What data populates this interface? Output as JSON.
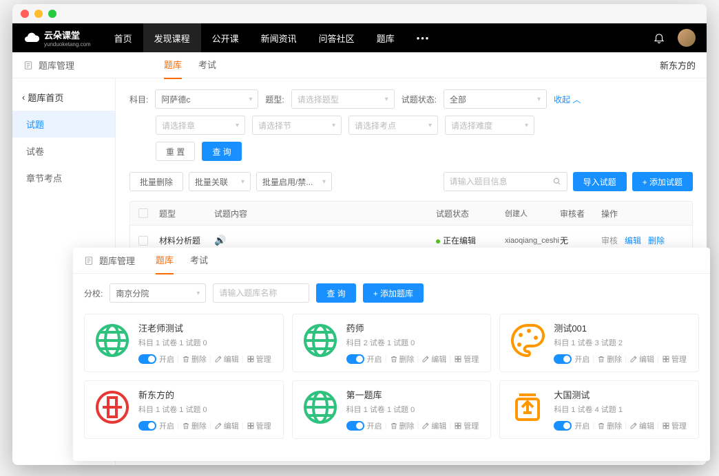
{
  "logo": {
    "text": "云朵课堂",
    "sub": "yunduoketang.com"
  },
  "nav": {
    "items": [
      "首页",
      "发现课程",
      "公开课",
      "新闻资讯",
      "问答社区",
      "题库"
    ],
    "active_index": 1
  },
  "subheader": {
    "title": "题库管理",
    "tabs": [
      "题库",
      "考试"
    ],
    "active_tab": 0,
    "right_text": "新东方的"
  },
  "sidebar": {
    "back": "题库首页",
    "items": [
      "试题",
      "试卷",
      "章节考点"
    ],
    "active_index": 0
  },
  "filters": {
    "subject_label": "科目:",
    "subject_value": "阿萨德c",
    "type_label": "题型:",
    "type_placeholder": "请选择题型",
    "status_label": "试题状态:",
    "status_value": "全部",
    "collapse": "收起",
    "chapter_placeholder": "请选择章",
    "section_placeholder": "请选择节",
    "point_placeholder": "请选择考点",
    "difficulty_placeholder": "请选择难度",
    "reset": "重 置",
    "query": "查 询"
  },
  "toolbar": {
    "batch_delete": "批量删除",
    "batch_relate": "批量关联",
    "batch_enable": "批量启用/禁...",
    "search_placeholder": "请输入题目信息",
    "import": "导入试题",
    "add": "+ 添加试题"
  },
  "table": {
    "headers": {
      "type": "题型",
      "content": "试题内容",
      "status": "试题状态",
      "creator": "创建人",
      "reviewer": "审核者",
      "actions": "操作"
    },
    "rows": [
      {
        "type": "材料分析题",
        "has_audio": true,
        "status": "正在编辑",
        "creator": "xiaoqiang_ceshi",
        "reviewer": "无",
        "actions": {
          "review": "审核",
          "edit": "编辑",
          "delete": "删除"
        }
      }
    ]
  },
  "overlay": {
    "title": "题库管理",
    "tabs": [
      "题库",
      "考试"
    ],
    "active_tab": 0,
    "branch_label": "分校:",
    "branch_value": "南京分院",
    "name_placeholder": "请输入题库名称",
    "query": "查 询",
    "add": "+ 添加题库",
    "action_labels": {
      "open": "开启",
      "delete": "删除",
      "edit": "编辑",
      "manage": "管理"
    },
    "cards": [
      {
        "title": "汪老师测试",
        "meta": "科目 1  试卷 1  试题 0",
        "icon": "globe-green"
      },
      {
        "title": "药师",
        "meta": "科目 2  试卷 1  试题 0",
        "icon": "globe-green"
      },
      {
        "title": "测试001",
        "meta": "科目 1  试卷 3  试题 2",
        "icon": "palette-orange"
      },
      {
        "title": "新东方的",
        "meta": "科目 1  试卷 1  试题 0",
        "icon": "coin-red"
      },
      {
        "title": "第一题库",
        "meta": "科目 1  试卷 1  试题 0",
        "icon": "globe-green"
      },
      {
        "title": "大国测试",
        "meta": "科目 1  试卷 4  试题 1",
        "icon": "jar-orange"
      }
    ]
  }
}
